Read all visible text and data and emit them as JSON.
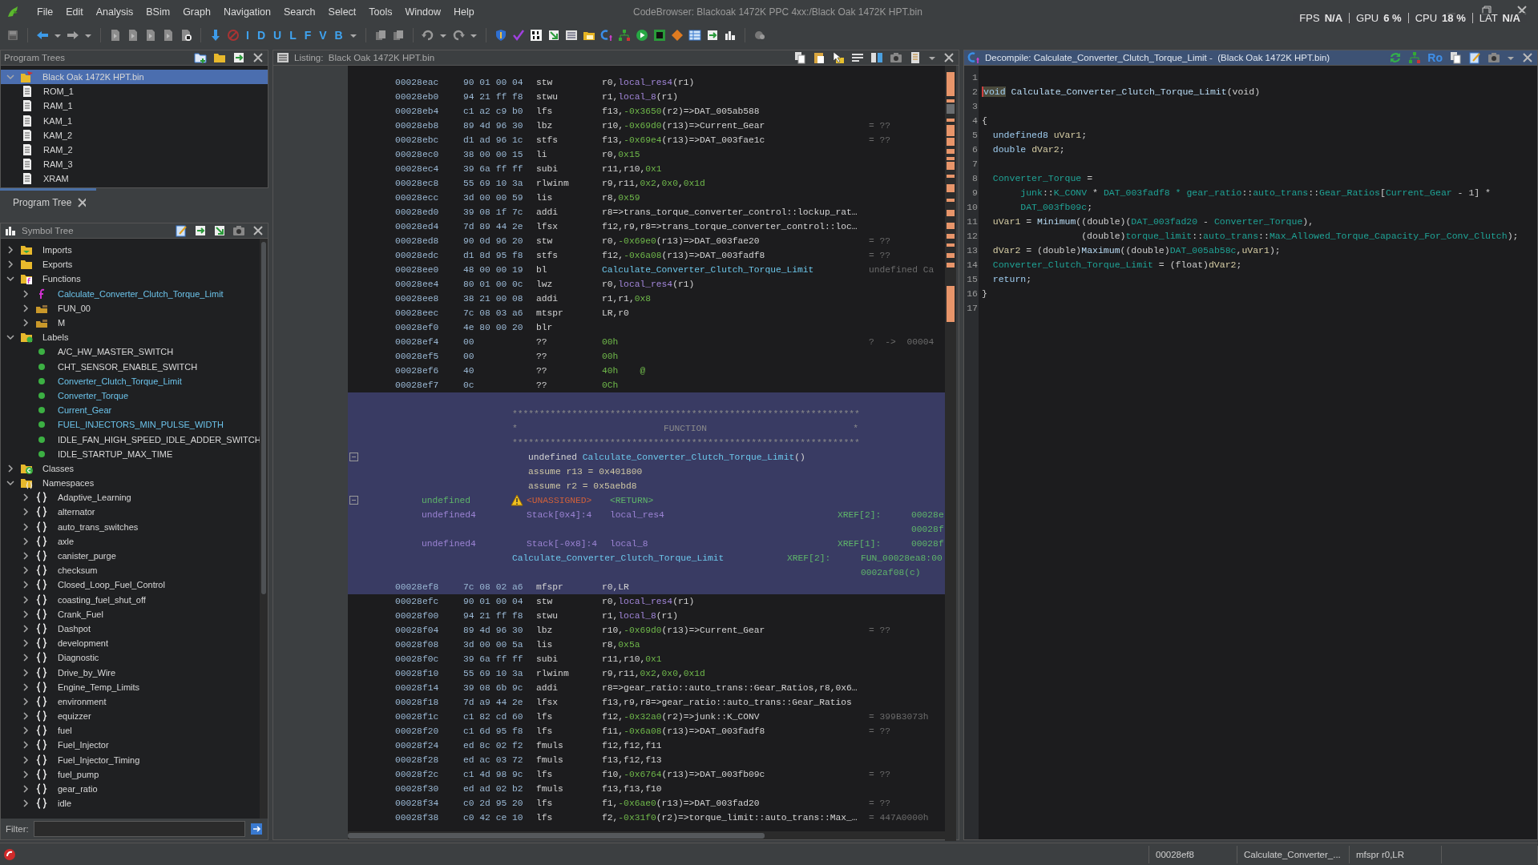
{
  "menu_bar": {
    "items": [
      "File",
      "Edit",
      "Analysis",
      "BSim",
      "Graph",
      "Navigation",
      "Search",
      "Select",
      "Tools",
      "Window",
      "Help"
    ],
    "title": "CodeBrowser: Blackoak 1472K PPC 4xx:/Black Oak 1472K HPT.bin"
  },
  "perf_overlay": [
    {
      "label": "FPS",
      "value": "N/A"
    },
    {
      "label": "GPU",
      "value": "6 %"
    },
    {
      "label": "CPU",
      "value": "18 %"
    },
    {
      "label": "LAT",
      "value": "N/A"
    }
  ],
  "toolbar": {
    "letter_buttons": [
      "I",
      "D",
      "U",
      "L",
      "F",
      "V",
      "B"
    ]
  },
  "program_trees": {
    "title": "Program Trees",
    "tab": "Program Tree",
    "root": {
      "label": "Black Oak 1472K HPT.bin",
      "selected": true,
      "expanded": true,
      "children": [
        {
          "label": "ROM_1",
          "selected": false
        },
        {
          "label": "RAM_1",
          "selected": false
        },
        {
          "label": "KAM_1",
          "selected": false
        },
        {
          "label": "KAM_2",
          "selected": false
        },
        {
          "label": "RAM_2",
          "selected": false
        },
        {
          "label": "RAM_3",
          "selected": false
        },
        {
          "label": "XRAM",
          "selected": false
        }
      ]
    }
  },
  "symbol_tree": {
    "title": "Symbol Tree",
    "filter_label": "Filter:",
    "items": [
      {
        "label": "Imports",
        "kind": "imports",
        "expanded": false
      },
      {
        "label": "Exports",
        "kind": "exports",
        "expanded": false
      },
      {
        "label": "Functions",
        "kind": "functions",
        "expanded": true,
        "children": [
          {
            "label": "Calculate_Converter_Clutch_Torque_Limit",
            "kind": "function",
            "expanded": false,
            "highlighted": true
          },
          {
            "label": "FUN_00",
            "kind": "folder",
            "expanded": false,
            "highlighted": false
          },
          {
            "label": "M",
            "kind": "folder",
            "expanded": false,
            "highlighted": false
          }
        ]
      },
      {
        "label": "Labels",
        "kind": "labels",
        "expanded": true,
        "children": [
          {
            "label": "A/C_HW_MASTER_SWITCH",
            "kind": "label",
            "highlighted": false
          },
          {
            "label": "CHT_SENSOR_ENABLE_SWITCH",
            "kind": "label",
            "highlighted": false
          },
          {
            "label": "Converter_Clutch_Torque_Limit",
            "kind": "label",
            "highlighted": true
          },
          {
            "label": "Converter_Torque",
            "kind": "label",
            "highlighted": true
          },
          {
            "label": "Current_Gear",
            "kind": "label",
            "highlighted": true
          },
          {
            "label": "FUEL_INJECTORS_MIN_PULSE_WIDTH",
            "kind": "label",
            "highlighted": true
          },
          {
            "label": "IDLE_FAN_HIGH_SPEED_IDLE_ADDER_SWITCH",
            "kind": "label",
            "highlighted": false
          },
          {
            "label": "IDLE_STARTUP_MAX_TIME",
            "kind": "label",
            "highlighted": false
          }
        ]
      },
      {
        "label": "Classes",
        "kind": "classes",
        "expanded": false
      },
      {
        "label": "Namespaces",
        "kind": "namespaces",
        "expanded": true,
        "children": [
          {
            "label": "Adaptive_Learning",
            "kind": "namespace",
            "expanded": false
          },
          {
            "label": "alternator",
            "kind": "namespace",
            "expanded": false
          },
          {
            "label": "auto_trans_switches",
            "kind": "namespace",
            "expanded": false
          },
          {
            "label": "axle",
            "kind": "namespace",
            "expanded": false
          },
          {
            "label": "canister_purge",
            "kind": "namespace",
            "expanded": false
          },
          {
            "label": "checksum",
            "kind": "namespace",
            "expanded": false
          },
          {
            "label": "Closed_Loop_Fuel_Control",
            "kind": "namespace",
            "expanded": false
          },
          {
            "label": "coasting_fuel_shut_off",
            "kind": "namespace",
            "expanded": false
          },
          {
            "label": "Crank_Fuel",
            "kind": "namespace",
            "expanded": false
          },
          {
            "label": "Dashpot",
            "kind": "namespace",
            "expanded": false
          },
          {
            "label": "development",
            "kind": "namespace",
            "expanded": false
          },
          {
            "label": "Diagnostic",
            "kind": "namespace",
            "expanded": false
          },
          {
            "label": "Drive_by_Wire",
            "kind": "namespace",
            "expanded": false
          },
          {
            "label": "Engine_Temp_Limits",
            "kind": "namespace",
            "expanded": false
          },
          {
            "label": "environment",
            "kind": "namespace",
            "expanded": false
          },
          {
            "label": "equizzer",
            "kind": "namespace",
            "expanded": false
          },
          {
            "label": "fuel",
            "kind": "namespace",
            "expanded": false
          },
          {
            "label": "Fuel_Injector",
            "kind": "namespace",
            "expanded": false
          },
          {
            "label": "Fuel_Injector_Timing",
            "kind": "namespace",
            "expanded": false
          },
          {
            "label": "fuel_pump",
            "kind": "namespace",
            "expanded": false
          },
          {
            "label": "gear_ratio",
            "kind": "namespace",
            "expanded": false
          },
          {
            "label": "idle",
            "kind": "namespace",
            "expanded": false
          }
        ]
      }
    ]
  },
  "listing": {
    "title": "Listing:  Black Oak 1472K HPT.bin",
    "lines": [
      {
        "kind": "insn",
        "selected": false,
        "address": "00028eac",
        "bytes": "90 01 00 04",
        "mnemonic": "stw",
        "operands": [
          {
            "text": "r0,",
            "kind": "reg"
          },
          {
            "text": "local_res4",
            "kind": "local"
          },
          {
            "text": "(r1)",
            "kind": "reg"
          }
        ]
      },
      {
        "kind": "insn",
        "selected": false,
        "address": "00028eb0",
        "bytes": "94 21 ff f8",
        "mnemonic": "stwu",
        "operands": [
          {
            "text": "r1,",
            "kind": "reg"
          },
          {
            "text": "local_8",
            "kind": "local"
          },
          {
            "text": "(r1)",
            "kind": "reg"
          }
        ]
      },
      {
        "kind": "insn",
        "selected": false,
        "address": "00028eb4",
        "bytes": "c1 a2 c9 b0",
        "mnemonic": "lfs",
        "operands": [
          {
            "text": "f13,",
            "kind": "reg"
          },
          {
            "text": "-0x3650",
            "kind": "num"
          },
          {
            "text": "(r2)=>DAT_005ab588",
            "kind": "reg"
          }
        ]
      },
      {
        "kind": "insn",
        "selected": false,
        "address": "00028eb8",
        "bytes": "89 4d 96 30",
        "mnemonic": "lbz",
        "operands": [
          {
            "text": "r10,",
            "kind": "reg"
          },
          {
            "text": "-0x69d0",
            "kind": "num"
          },
          {
            "text": "(r13)=>Current_Gear",
            "kind": "reg"
          }
        ],
        "comment": "= ??"
      },
      {
        "kind": "insn",
        "selected": false,
        "address": "00028ebc",
        "bytes": "d1 ad 96 1c",
        "mnemonic": "stfs",
        "operands": [
          {
            "text": "f13,",
            "kind": "reg"
          },
          {
            "text": "-0x69e4",
            "kind": "num"
          },
          {
            "text": "(r13)=>DAT_003fae1c",
            "kind": "reg"
          }
        ],
        "comment": "= ??"
      },
      {
        "kind": "insn",
        "selected": false,
        "address": "00028ec0",
        "bytes": "38 00 00 15",
        "mnemonic": "li",
        "operands": [
          {
            "text": "r0,",
            "kind": "reg"
          },
          {
            "text": "0x15",
            "kind": "num"
          }
        ]
      },
      {
        "kind": "insn",
        "selected": false,
        "address": "00028ec4",
        "bytes": "39 6a ff ff",
        "mnemonic": "subi",
        "operands": [
          {
            "text": "r11,r10,",
            "kind": "reg"
          },
          {
            "text": "0x1",
            "kind": "num"
          }
        ]
      },
      {
        "kind": "insn",
        "selected": false,
        "address": "00028ec8",
        "bytes": "55 69 10 3a",
        "mnemonic": "rlwinm",
        "operands": [
          {
            "text": "r9,r11,",
            "kind": "reg"
          },
          {
            "text": "0x2",
            "kind": "num"
          },
          {
            "text": ",",
            "kind": "reg"
          },
          {
            "text": "0x0",
            "kind": "num"
          },
          {
            "text": ",",
            "kind": "reg"
          },
          {
            "text": "0x1d",
            "kind": "num"
          }
        ]
      },
      {
        "kind": "insn",
        "selected": false,
        "address": "00028ecc",
        "bytes": "3d 00 00 59",
        "mnemonic": "lis",
        "operands": [
          {
            "text": "r8,",
            "kind": "reg"
          },
          {
            "text": "0x59",
            "kind": "num"
          }
        ]
      },
      {
        "kind": "insn",
        "selected": false,
        "address": "00028ed0",
        "bytes": "39 08 1f 7c",
        "mnemonic": "addi",
        "operands": [
          {
            "text": "r8=>trans_torque_converter_control::lockup_rat…",
            "kind": "reg"
          }
        ]
      },
      {
        "kind": "insn",
        "selected": false,
        "address": "00028ed4",
        "bytes": "7d 89 44 2e",
        "mnemonic": "lfsx",
        "operands": [
          {
            "text": "f12,r9,r8=>trans_torque_converter_control::loc…",
            "kind": "reg"
          }
        ]
      },
      {
        "kind": "insn",
        "selected": false,
        "address": "00028ed8",
        "bytes": "90 0d 96 20",
        "mnemonic": "stw",
        "operands": [
          {
            "text": "r0,",
            "kind": "reg"
          },
          {
            "text": "-0x69e0",
            "kind": "num"
          },
          {
            "text": "(r13)=>DAT_003fae20",
            "kind": "reg"
          }
        ],
        "comment": "= ??"
      },
      {
        "kind": "insn",
        "selected": false,
        "address": "00028edc",
        "bytes": "d1 8d 95 f8",
        "mnemonic": "stfs",
        "operands": [
          {
            "text": "f12,",
            "kind": "reg"
          },
          {
            "text": "-0x6a08",
            "kind": "num"
          },
          {
            "text": "(r13)=>DAT_003fadf8",
            "kind": "reg"
          }
        ],
        "comment": "= ??"
      },
      {
        "kind": "insn",
        "selected": false,
        "address": "00028ee0",
        "bytes": "48 00 00 19",
        "mnemonic": "bl",
        "operands": [
          {
            "text": "Calculate_Converter_Clutch_Torque_Limit",
            "kind": "fn"
          }
        ],
        "comment": "undefined Ca"
      },
      {
        "kind": "insn",
        "selected": false,
        "address": "00028ee4",
        "bytes": "80 01 00 0c",
        "mnemonic": "lwz",
        "operands": [
          {
            "text": "r0,",
            "kind": "reg"
          },
          {
            "text": "local_res4",
            "kind": "local"
          },
          {
            "text": "(r1)",
            "kind": "reg"
          }
        ]
      },
      {
        "kind": "insn",
        "selected": false,
        "address": "00028ee8",
        "bytes": "38 21 00 08",
        "mnemonic": "addi",
        "operands": [
          {
            "text": "r1,r1,",
            "kind": "reg"
          },
          {
            "text": "0x8",
            "kind": "num"
          }
        ]
      },
      {
        "kind": "insn",
        "selected": false,
        "address": "00028eec",
        "bytes": "7c 08 03 a6",
        "mnemonic": "mtspr",
        "operands": [
          {
            "text": "LR,r0",
            "kind": "reg"
          }
        ]
      },
      {
        "kind": "insn",
        "selected": false,
        "address": "00028ef0",
        "bytes": "4e 80 00 20",
        "mnemonic": "blr"
      },
      {
        "kind": "insn",
        "selected": false,
        "address": "00028ef4",
        "bytes": "00",
        "mnemonic": "??",
        "operands": [
          {
            "text": "00h",
            "kind": "num"
          }
        ],
        "comment": "?  ->  00004"
      },
      {
        "kind": "insn",
        "selected": false,
        "address": "00028ef5",
        "bytes": "00",
        "mnemonic": "??",
        "operands": [
          {
            "text": "00h",
            "kind": "num"
          }
        ]
      },
      {
        "kind": "insn",
        "selected": false,
        "address": "00028ef6",
        "bytes": "40",
        "mnemonic": "??",
        "operands": [
          {
            "text": "40h    @",
            "kind": "num"
          }
        ]
      },
      {
        "kind": "insn",
        "selected": false,
        "address": "00028ef7",
        "bytes": "0c",
        "mnemonic": "??",
        "operands": [
          {
            "text": "0Ch",
            "kind": "num"
          }
        ]
      },
      {
        "kind": "blank",
        "selected": true
      },
      {
        "kind": "stars",
        "selected": true,
        "text": "****************************************************************"
      },
      {
        "kind": "banner",
        "selected": true,
        "left": "*",
        "title": "FUNCTION",
        "right": "*"
      },
      {
        "kind": "stars",
        "selected": true,
        "text": "****************************************************************"
      },
      {
        "kind": "signature",
        "selected": true,
        "expanded": true,
        "tokens": [
          {
            "text": "undefined ",
            "kind": "reg"
          },
          {
            "text": "Calculate_Converter_Clutch_Torque_Limit",
            "kind": "fn"
          },
          {
            "text": "()",
            "kind": "reg"
          }
        ]
      },
      {
        "kind": "assume",
        "selected": true,
        "text": "assume r13 = 0x401800"
      },
      {
        "kind": "assume",
        "selected": true,
        "text": "assume r2 = 0x5aebd8"
      },
      {
        "kind": "return_param",
        "selected": true,
        "expanded": true,
        "warning": true,
        "type": "undefined",
        "storage": "<UNASSIGNED>",
        "name": "<RETURN>"
      },
      {
        "kind": "stack_param",
        "selected": true,
        "warning": false,
        "type": "undefined4",
        "storage": "Stack[0x4]:4",
        "name": "local_res4",
        "xref": "XREF[2]:",
        "target": "00028e"
      },
      {
        "kind": "xref_cont",
        "selected": true,
        "target": "00028f"
      },
      {
        "kind": "stack_param",
        "selected": true,
        "warning": false,
        "type": "undefined4",
        "storage": "Stack[-0x8]:4",
        "name": "local_8",
        "xref": "XREF[1]:",
        "target": "00028f"
      },
      {
        "kind": "label",
        "selected": true,
        "name": "Calculate_Converter_Clutch_Torque_Limit",
        "xref": "XREF[2]:",
        "target": "FUN_00028ea8:00"
      },
      {
        "kind": "label_xref_cont",
        "selected": true,
        "target": "0002af08(c)"
      },
      {
        "kind": "insn",
        "selected": true,
        "address": "00028ef8",
        "bytes": "7c 08 02 a6",
        "mnemonic": "mfspr",
        "operands": [
          {
            "text": "r0,LR",
            "kind": "reg"
          }
        ]
      },
      {
        "kind": "insn",
        "selected": false,
        "address": "00028efc",
        "bytes": "90 01 00 04",
        "mnemonic": "stw",
        "operands": [
          {
            "text": "r0,",
            "kind": "reg"
          },
          {
            "text": "local_res4",
            "kind": "local"
          },
          {
            "text": "(r1)",
            "kind": "reg"
          }
        ]
      },
      {
        "kind": "insn",
        "selected": false,
        "address": "00028f00",
        "bytes": "94 21 ff f8",
        "mnemonic": "stwu",
        "operands": [
          {
            "text": "r1,",
            "kind": "reg"
          },
          {
            "text": "local_8",
            "kind": "local"
          },
          {
            "text": "(r1)",
            "kind": "reg"
          }
        ]
      },
      {
        "kind": "insn",
        "selected": false,
        "address": "00028f04",
        "bytes": "89 4d 96 30",
        "mnemonic": "lbz",
        "operands": [
          {
            "text": "r10,",
            "kind": "reg"
          },
          {
            "text": "-0x69d0",
            "kind": "num"
          },
          {
            "text": "(r13)=>Current_Gear",
            "kind": "reg"
          }
        ],
        "comment": "= ??"
      },
      {
        "kind": "insn",
        "selected": false,
        "address": "00028f08",
        "bytes": "3d 00 00 5a",
        "mnemonic": "lis",
        "operands": [
          {
            "text": "r8,",
            "kind": "reg"
          },
          {
            "text": "0x5a",
            "kind": "num"
          }
        ]
      },
      {
        "kind": "insn",
        "selected": false,
        "address": "00028f0c",
        "bytes": "39 6a ff ff",
        "mnemonic": "subi",
        "operands": [
          {
            "text": "r11,r10,",
            "kind": "reg"
          },
          {
            "text": "0x1",
            "kind": "num"
          }
        ]
      },
      {
        "kind": "insn",
        "selected": false,
        "address": "00028f10",
        "bytes": "55 69 10 3a",
        "mnemonic": "rlwinm",
        "operands": [
          {
            "text": "r9,r11,",
            "kind": "reg"
          },
          {
            "text": "0x2",
            "kind": "num"
          },
          {
            "text": ",",
            "kind": "reg"
          },
          {
            "text": "0x0",
            "kind": "num"
          },
          {
            "text": ",",
            "kind": "reg"
          },
          {
            "text": "0x1d",
            "kind": "num"
          }
        ]
      },
      {
        "kind": "insn",
        "selected": false,
        "address": "00028f14",
        "bytes": "39 08 6b 9c",
        "mnemonic": "addi",
        "operands": [
          {
            "text": "r8=>gear_ratio::auto_trans::Gear_Ratios,r8,0x6…",
            "kind": "reg"
          }
        ]
      },
      {
        "kind": "insn",
        "selected": false,
        "address": "00028f18",
        "bytes": "7d a9 44 2e",
        "mnemonic": "lfsx",
        "operands": [
          {
            "text": "f13,r9,r8=>gear_ratio::auto_trans::Gear_Ratios",
            "kind": "reg"
          }
        ]
      },
      {
        "kind": "insn",
        "selected": false,
        "address": "00028f1c",
        "bytes": "c1 82 cd 60",
        "mnemonic": "lfs",
        "operands": [
          {
            "text": "f12,",
            "kind": "reg"
          },
          {
            "text": "-0x32a0",
            "kind": "num"
          },
          {
            "text": "(r2)=>junk::K_CONV",
            "kind": "reg"
          }
        ],
        "comment": "= 399B3073h"
      },
      {
        "kind": "insn",
        "selected": false,
        "address": "00028f20",
        "bytes": "c1 6d 95 f8",
        "mnemonic": "lfs",
        "operands": [
          {
            "text": "f11,",
            "kind": "reg"
          },
          {
            "text": "-0x6a08",
            "kind": "num"
          },
          {
            "text": "(r13)=>DAT_003fadf8",
            "kind": "reg"
          }
        ],
        "comment": "= ??"
      },
      {
        "kind": "insn",
        "selected": false,
        "address": "00028f24",
        "bytes": "ed 8c 02 f2",
        "mnemonic": "fmuls",
        "operands": [
          {
            "text": "f12,f12,f11",
            "kind": "reg"
          }
        ]
      },
      {
        "kind": "insn",
        "selected": false,
        "address": "00028f28",
        "bytes": "ed ac 03 72",
        "mnemonic": "fmuls",
        "operands": [
          {
            "text": "f13,f12,f13",
            "kind": "reg"
          }
        ]
      },
      {
        "kind": "insn",
        "selected": false,
        "address": "00028f2c",
        "bytes": "c1 4d 98 9c",
        "mnemonic": "lfs",
        "operands": [
          {
            "text": "f10,",
            "kind": "reg"
          },
          {
            "text": "-0x6764",
            "kind": "num"
          },
          {
            "text": "(r13)=>DAT_003fb09c",
            "kind": "reg"
          }
        ],
        "comment": "= ??"
      },
      {
        "kind": "insn",
        "selected": false,
        "address": "00028f30",
        "bytes": "ed ad 02 b2",
        "mnemonic": "fmuls",
        "operands": [
          {
            "text": "f13,f13,f10",
            "kind": "reg"
          }
        ]
      },
      {
        "kind": "insn",
        "selected": false,
        "address": "00028f34",
        "bytes": "c0 2d 95 20",
        "mnemonic": "lfs",
        "operands": [
          {
            "text": "f1,",
            "kind": "reg"
          },
          {
            "text": "-0x6ae0",
            "kind": "num"
          },
          {
            "text": "(r13)=>DAT_003fad20",
            "kind": "reg"
          }
        ],
        "comment": "= ??"
      },
      {
        "kind": "insn",
        "selected": false,
        "address": "00028f38",
        "bytes": "c0 42 ce 10",
        "mnemonic": "lfs",
        "operands": [
          {
            "text": "f2,",
            "kind": "reg"
          },
          {
            "text": "-0x31f0",
            "kind": "num"
          },
          {
            "text": "(r2)=>torque_limit::auto_trans::Max_…",
            "kind": "reg"
          }
        ],
        "comment": "= 447A0000h"
      }
    ]
  },
  "decompiler": {
    "title": "Decompile: Calculate_Converter_Clutch_Torque_Limit -  (Black Oak 1472K HPT.bin)",
    "toolbar_text": "Ro",
    "lines": [
      {
        "number": "1"
      },
      {
        "number": "2",
        "tokens": [
          {
            "text": "void",
            "kind": "cursor_kw"
          },
          {
            "text": " Calculate_Converter_Clutch_Torque_Limit",
            "kind": "fn"
          },
          {
            "text": "(void)",
            "kind": "punct"
          }
        ]
      },
      {
        "number": "3"
      },
      {
        "number": "4",
        "tokens": [
          {
            "text": "{",
            "kind": "punct"
          }
        ]
      },
      {
        "number": "5",
        "tokens": [
          {
            "text": "  undefined8 ",
            "kind": "kw"
          },
          {
            "text": "uVar1",
            "kind": "local"
          },
          {
            "text": ";",
            "kind": "punct"
          }
        ]
      },
      {
        "number": "6",
        "tokens": [
          {
            "text": "  double ",
            "kind": "kw"
          },
          {
            "text": "dVar2",
            "kind": "local"
          },
          {
            "text": ";",
            "kind": "punct"
          }
        ]
      },
      {
        "number": "7"
      },
      {
        "number": "8",
        "tokens": [
          {
            "text": "  Converter_Torque",
            "kind": "global"
          },
          {
            "text": " =",
            "kind": "punct"
          }
        ]
      },
      {
        "number": "9",
        "tokens": [
          {
            "text": "       junk",
            "kind": "global"
          },
          {
            "text": "::",
            "kind": "punct"
          },
          {
            "text": "K_CONV",
            "kind": "global"
          },
          {
            "text": " * ",
            "kind": "punct"
          },
          {
            "text": "DAT_003fadf8 * gear_ratio",
            "kind": "global"
          },
          {
            "text": "::",
            "kind": "punct"
          },
          {
            "text": "auto_trans",
            "kind": "global"
          },
          {
            "text": "::",
            "kind": "punct"
          },
          {
            "text": "Gear_Ratios",
            "kind": "global"
          },
          {
            "text": "[",
            "kind": "punct"
          },
          {
            "text": "Current_Gear",
            "kind": "global"
          },
          {
            "text": " - 1] *",
            "kind": "punct"
          }
        ]
      },
      {
        "number": "10",
        "tokens": [
          {
            "text": "       DAT_003fb09c",
            "kind": "global"
          },
          {
            "text": ";",
            "kind": "punct"
          }
        ]
      },
      {
        "number": "11",
        "tokens": [
          {
            "text": "  uVar1",
            "kind": "local"
          },
          {
            "text": " = ",
            "kind": "punct"
          },
          {
            "text": "Minimum",
            "kind": "fn"
          },
          {
            "text": "((double)(",
            "kind": "punct"
          },
          {
            "text": "DAT_003fad20",
            "kind": "global"
          },
          {
            "text": " - ",
            "kind": "punct"
          },
          {
            "text": "Converter_Torque",
            "kind": "global"
          },
          {
            "text": "),",
            "kind": "punct"
          }
        ]
      },
      {
        "number": "12",
        "tokens": [
          {
            "text": "                  (double)",
            "kind": "punct"
          },
          {
            "text": "torque_limit",
            "kind": "global"
          },
          {
            "text": "::",
            "kind": "punct"
          },
          {
            "text": "auto_trans",
            "kind": "global"
          },
          {
            "text": "::",
            "kind": "punct"
          },
          {
            "text": "Max_Allowed_Torque_Capacity_For_Conv_Clutch",
            "kind": "global"
          },
          {
            "text": ");",
            "kind": "punct"
          }
        ]
      },
      {
        "number": "13",
        "tokens": [
          {
            "text": "  dVar2",
            "kind": "local"
          },
          {
            "text": " = (double)",
            "kind": "punct"
          },
          {
            "text": "Maximum",
            "kind": "fn"
          },
          {
            "text": "((double)",
            "kind": "punct"
          },
          {
            "text": "DAT_005ab58c",
            "kind": "global"
          },
          {
            "text": ",",
            "kind": "punct"
          },
          {
            "text": "uVar1",
            "kind": "local"
          },
          {
            "text": ");",
            "kind": "punct"
          }
        ]
      },
      {
        "number": "14",
        "tokens": [
          {
            "text": "  Converter_Clutch_Torque_Limit",
            "kind": "global"
          },
          {
            "text": " = (float)",
            "kind": "punct"
          },
          {
            "text": "dVar2",
            "kind": "local"
          },
          {
            "text": ";",
            "kind": "punct"
          }
        ]
      },
      {
        "number": "15",
        "tokens": [
          {
            "text": "  return",
            "kind": "kw"
          },
          {
            "text": ";",
            "kind": "punct"
          }
        ]
      },
      {
        "number": "16",
        "tokens": [
          {
            "text": "}",
            "kind": "punct"
          }
        ]
      },
      {
        "number": "17"
      }
    ]
  },
  "status_bar": [
    "00028ef8",
    "Calculate_Converter_...",
    "mfspr r0,LR"
  ]
}
